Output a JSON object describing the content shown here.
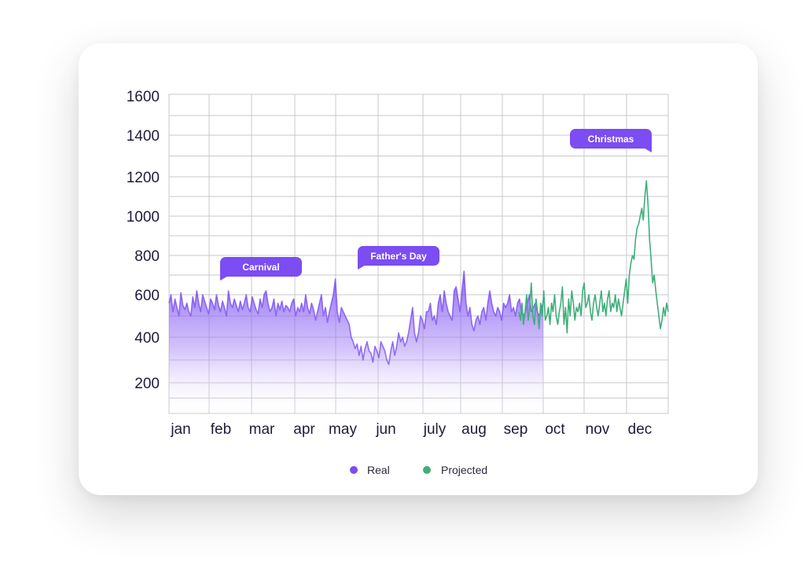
{
  "colors": {
    "real": "#7b4df2",
    "projected": "#3fae7a",
    "bubble": "#7b4df2",
    "grid": "#c9c9cf",
    "text": "#1f1b3a"
  },
  "chart_data": {
    "type": "area",
    "y_ticks": [
      200,
      400,
      600,
      800,
      1000,
      1200,
      1400,
      1600
    ],
    "ylim": [
      0,
      1600
    ],
    "categories": [
      "jan",
      "feb",
      "mar",
      "apr",
      "may",
      "jun",
      "july",
      "aug",
      "sep",
      "oct",
      "nov",
      "dec"
    ],
    "grid": true,
    "legend_position": "bottom-center",
    "series": [
      {
        "name": "Real",
        "color": "#7b4df2",
        "fill": "gradient",
        "x_range": [
          "jan",
          "sep"
        ],
        "values": [
          560,
          600,
          520,
          580,
          540,
          500,
          610,
          550,
          530,
          560,
          520,
          500,
          590,
          540,
          620,
          560,
          520,
          600,
          570,
          540,
          510,
          580,
          560,
          530,
          600,
          550,
          520,
          570,
          540,
          500,
          620,
          560,
          540,
          580,
          550,
          520,
          570,
          530,
          560,
          600,
          540,
          520,
          590,
          560,
          530,
          510,
          580,
          540,
          600,
          620,
          560,
          520,
          540,
          580,
          500,
          560,
          530,
          570,
          520,
          550,
          540,
          520,
          560,
          580,
          500,
          540,
          520,
          560,
          520,
          600,
          540,
          510,
          560,
          530,
          480,
          520,
          560,
          600,
          500,
          540,
          470,
          520,
          560,
          600,
          680,
          520,
          470,
          540,
          520,
          500,
          480,
          460,
          400,
          380,
          350,
          370,
          320,
          360,
          300,
          350,
          380,
          340,
          330,
          290,
          360,
          340,
          310,
          380,
          360,
          340,
          300,
          280,
          340,
          380,
          320,
          360,
          420,
          380,
          400,
          360,
          380,
          420,
          480,
          540,
          420,
          380,
          420,
          500,
          480,
          440,
          520,
          520,
          560,
          480,
          500,
          460,
          560,
          600,
          520,
          620,
          560,
          520,
          500,
          480,
          620,
          640,
          580,
          520,
          620,
          720,
          560,
          500,
          540,
          460,
          430,
          480,
          500,
          460,
          520,
          540,
          480,
          560,
          620,
          560,
          520,
          500,
          540,
          520,
          480,
          560,
          540,
          560,
          600,
          520,
          540,
          500,
          560,
          580,
          520,
          500,
          520,
          560,
          600,
          520,
          540,
          560,
          520,
          500,
          540,
          560
        ]
      },
      {
        "name": "Projected",
        "color": "#3fae7a",
        "x_range": [
          "sep",
          "dec"
        ],
        "values": [
          520,
          480,
          560,
          460,
          520,
          600,
          480,
          540,
          660,
          500,
          460,
          580,
          520,
          440,
          560,
          500,
          620,
          480,
          500,
          540,
          460,
          560,
          520,
          600,
          500,
          460,
          520,
          560,
          640,
          460,
          540,
          420,
          580,
          500,
          620,
          560,
          480,
          540,
          520,
          560,
          500,
          620,
          660,
          540,
          560,
          600,
          520,
          480,
          560,
          600,
          540,
          500,
          560,
          620,
          520,
          560,
          500,
          580,
          620,
          520,
          560,
          540,
          600,
          520,
          580,
          540,
          500,
          560,
          620,
          680,
          560,
          700,
          760,
          800,
          780,
          880,
          940,
          960,
          1000,
          1040,
          980,
          1100,
          1180,
          1060,
          880,
          780,
          660,
          700,
          620,
          560,
          500,
          440,
          480,
          540,
          500,
          560,
          520
        ]
      }
    ],
    "annotations": [
      {
        "label": "Carnival",
        "month": "feb"
      },
      {
        "label": "Father's Day",
        "month": "may"
      },
      {
        "label": "Christmas",
        "month": "nov"
      }
    ]
  }
}
